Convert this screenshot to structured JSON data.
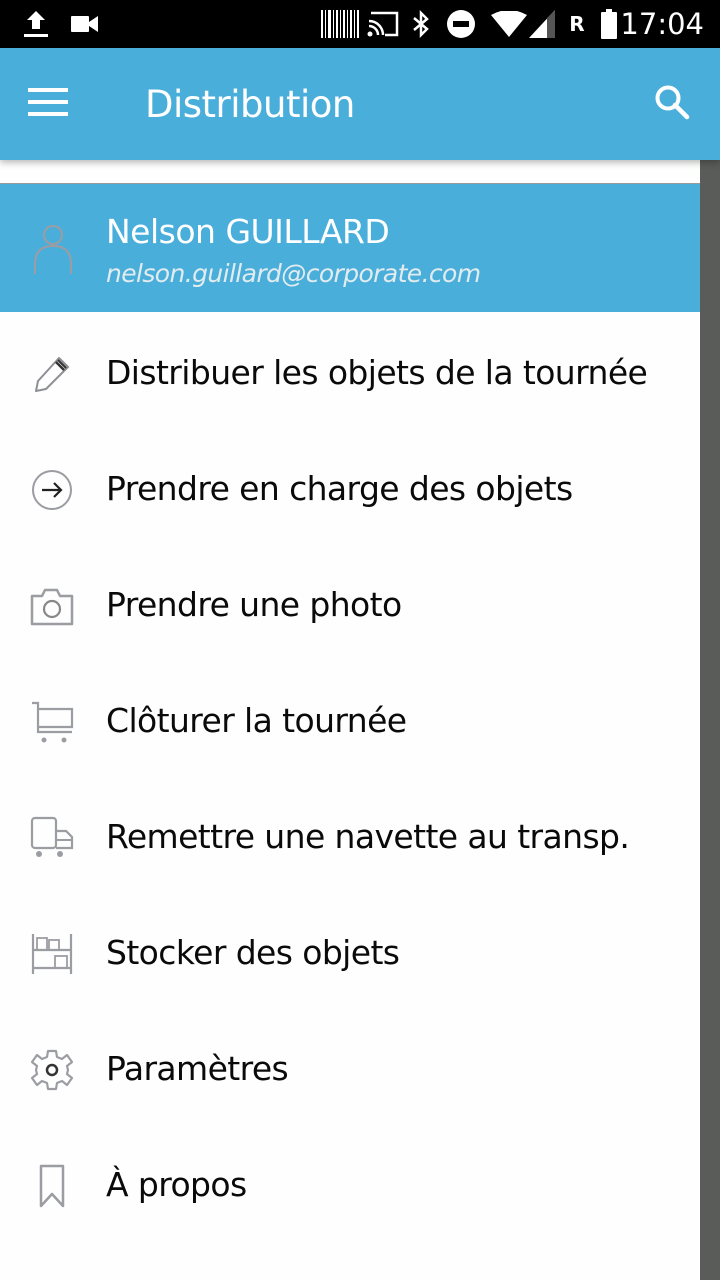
{
  "status_bar": {
    "icons": [
      "upload-icon",
      "video-camera-icon",
      "barcode-icon",
      "cast-icon",
      "bluetooth-icon",
      "do-not-disturb-icon",
      "wifi-icon",
      "cell-signal-icon",
      "roaming-indicator",
      "battery-icon"
    ],
    "roaming_letter": "R",
    "time": "17:04"
  },
  "app_bar": {
    "menu_icon": "hamburger-menu-icon",
    "title": "Distribution",
    "search_icon": "search-icon",
    "color": "#4aaedb"
  },
  "drawer": {
    "header": {
      "avatar_icon": "person-icon",
      "name": "Nelson GUILLARD",
      "email": "nelson.guillard@corporate.com",
      "color": "#4aaedb"
    },
    "items": [
      {
        "icon": "pencil-icon",
        "label": "Distribuer les objets de la tournée"
      },
      {
        "icon": "arrow-circle-right-icon",
        "label": "Prendre en charge des objets"
      },
      {
        "icon": "camera-icon",
        "label": "Prendre une photo"
      },
      {
        "icon": "cart-icon",
        "label": "Clôturer la tournée"
      },
      {
        "icon": "truck-icon",
        "label": "Remettre une navette au transp."
      },
      {
        "icon": "shelf-icon",
        "label": "Stocker des objets"
      },
      {
        "icon": "gear-icon",
        "label": "Paramètres"
      },
      {
        "icon": "bookmark-icon",
        "label": "À propos"
      }
    ]
  }
}
